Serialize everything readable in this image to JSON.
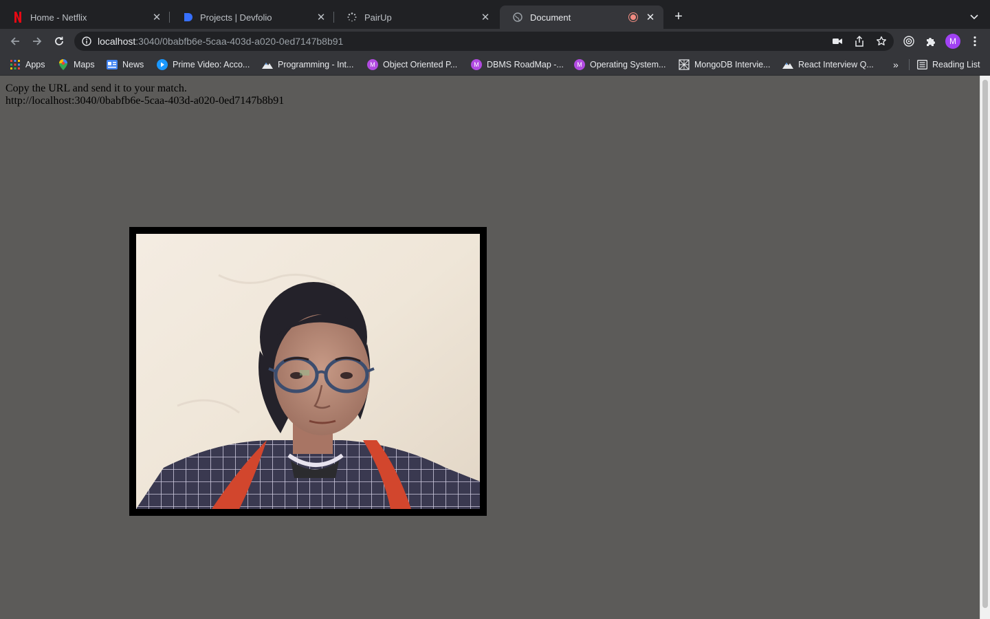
{
  "browser": {
    "tabs": [
      {
        "title": "Home - Netflix",
        "icon": "netflix-icon",
        "active": false
      },
      {
        "title": "Projects | Devfolio",
        "icon": "devfolio-icon",
        "active": false
      },
      {
        "title": "PairUp",
        "icon": "loading-spinner-icon",
        "active": false
      },
      {
        "title": "Document",
        "icon": "globe-icon",
        "active": true,
        "recording": true
      }
    ],
    "address_bar": {
      "host": "localhost",
      "path": ":3040/0babfb6e-5caa-403d-a020-0ed7147b8b91"
    },
    "profile_initial": "M",
    "bookmarks": [
      {
        "label": "Apps",
        "icon": "apps-grid-icon"
      },
      {
        "label": "Maps",
        "icon": "maps-pin-icon"
      },
      {
        "label": "News",
        "icon": "google-news-icon"
      },
      {
        "label": "Prime Video: Acco...",
        "icon": "prime-video-icon"
      },
      {
        "label": "Programming - Int...",
        "icon": "mountain-icon"
      },
      {
        "label": "Object Oriented P...",
        "icon": "m-badge-icon",
        "badge": "M"
      },
      {
        "label": "DBMS RoadMap -...",
        "icon": "m-badge-icon",
        "badge": "M"
      },
      {
        "label": "Operating System...",
        "icon": "m-badge-icon",
        "badge": "M"
      },
      {
        "label": "MongoDB Intervie...",
        "icon": "mongodb-logo-icon"
      },
      {
        "label": "React Interview Q...",
        "icon": "mountain-icon"
      }
    ],
    "overflow_label": "»",
    "reading_list_label": "Reading List"
  },
  "page": {
    "instruction": "Copy the URL and send it to your match.",
    "share_url": "http://localhost:3040/0babfb6e-5caa-403d-a020-0ed7147b8b91"
  },
  "colors": {
    "page_background": "#5c5b59",
    "video_border": "#000000",
    "tab_strip": "#202124",
    "toolbar": "#35363a",
    "profile_avatar": "#a142f4",
    "recording_indicator": "#f28b82"
  }
}
